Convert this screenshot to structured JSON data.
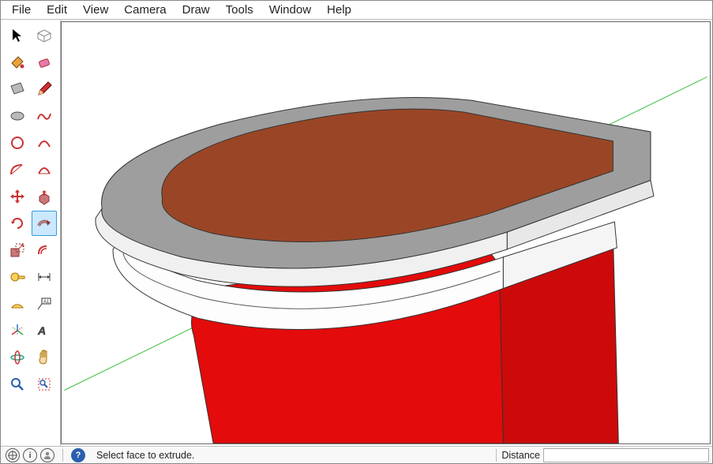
{
  "menu": {
    "items": [
      "File",
      "Edit",
      "View",
      "Camera",
      "Draw",
      "Tools",
      "Window",
      "Help"
    ]
  },
  "toolbar": {
    "rows": [
      [
        "select-arrow",
        "component"
      ],
      [
        "paint-bucket",
        "eraser"
      ],
      [
        "rectangle",
        "line"
      ],
      [
        "circle",
        "freehand"
      ],
      [
        "polygon",
        "arc"
      ],
      [
        "curve-1",
        "curve-2"
      ],
      [
        "move",
        "push-pull"
      ],
      [
        "rotate",
        "follow-me"
      ],
      [
        "scale",
        "offset"
      ],
      [
        "tape-measure",
        "dimension"
      ],
      [
        "protractor",
        "text-label"
      ],
      [
        "axes",
        "3d-text"
      ],
      [
        "orbit",
        "pan"
      ],
      [
        "zoom",
        "zoom-extents"
      ]
    ],
    "active": "follow-me"
  },
  "status": {
    "hint": "Select face to extrude.",
    "distance_label": "Distance",
    "distance_value": ""
  }
}
